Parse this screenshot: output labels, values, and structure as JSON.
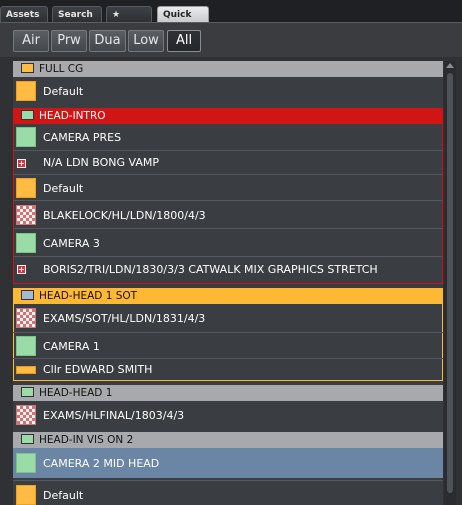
{
  "tabs": [
    {
      "label": "Assets"
    },
    {
      "label": "Search"
    },
    {
      "label": "★"
    },
    {
      "label": "Quick",
      "active": true
    }
  ],
  "filters": [
    {
      "label": "Air"
    },
    {
      "label": "Prw"
    },
    {
      "label": "Dua"
    },
    {
      "label": "Low"
    },
    {
      "label": "All",
      "active": true
    }
  ],
  "groups": [
    {
      "title": "FULL CG",
      "style": "grey",
      "swatch": "#ffbb44",
      "items": [
        {
          "label": "Default",
          "thumb": "gold"
        }
      ]
    },
    {
      "title": "HEAD-INTRO",
      "style": "red",
      "swatch": "#9bdba7",
      "items": [
        {
          "label": "CAMERA PRES",
          "thumb": "green"
        },
        {
          "label": "N/A LDN BONG VAMP",
          "thumb": "plus"
        },
        {
          "label": "Default",
          "thumb": "gold"
        },
        {
          "label": "BLAKELOCK/HL/LDN/1800/4/3",
          "thumb": "check"
        },
        {
          "label": "CAMERA 3",
          "thumb": "green"
        },
        {
          "label": "BORIS2/TRI/LDN/1830/3/3 CATWALK MIX GRAPHICS STRETCH",
          "thumb": "plus"
        }
      ]
    },
    {
      "title": "HEAD-HEAD 1 SOT",
      "style": "orange",
      "swatch": "#a6b8d8",
      "items": [
        {
          "label": "EXAMS/SOT/HL/LDN/1831/4/3",
          "thumb": "check"
        },
        {
          "label": "CAMERA 1",
          "thumb": "green"
        },
        {
          "label": "Cllr EDWARD SMITH",
          "thumb": "bar"
        }
      ]
    },
    {
      "title": "HEAD-HEAD 1",
      "style": "grey",
      "swatch": "#9bdba7",
      "items": [
        {
          "label": "EXAMS/HLFINAL/1803/4/3",
          "thumb": "check"
        }
      ]
    },
    {
      "title": "HEAD-IN VIS ON 2",
      "style": "grey",
      "swatch": "#9bdba7",
      "items": [
        {
          "label": "CAMERA 2 MID HEAD",
          "thumb": "green",
          "selected": true
        },
        {
          "label": "Default",
          "thumb": "gold"
        }
      ]
    }
  ]
}
